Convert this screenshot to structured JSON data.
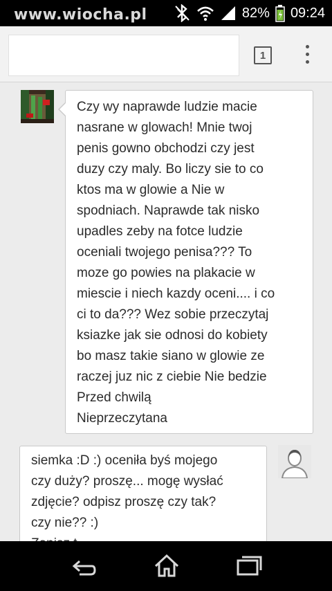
{
  "status_bar": {
    "watermark": "www.wiocha.pl",
    "battery_percent": "82%",
    "time": "09:24"
  },
  "browser": {
    "url_value": "",
    "tab_count": "1"
  },
  "messages": [
    {
      "lines": [
        "Czy wy naprawde ludzie macie",
        "nasrane w glowach! Mnie twoj",
        "penis gowno obchodzi czy jest",
        "duzy czy maly. Bo liczy sie to co",
        "ktos ma w glowie a Nie w",
        "spodniach. Naprawde tak nisko",
        "upadles zeby na fotce ludzie",
        "oceniali twojego penisa??? To",
        "moze go powies na plakacie w",
        "miescie i niech kazdy oceni.... i co",
        "ci to da??? Wez sobie przeczytaj",
        "ksiazke jak sie odnosi do kobiety",
        "bo masz takie siano w glowie ze",
        "raczej juz nic z ciebie Nie bedzie"
      ],
      "time_label": "Przed chwilą",
      "status_label": "Nieprzeczytana"
    },
    {
      "lines": [
        "siemka :D :) oceniła byś mojego",
        "czy duży? proszę... mogę wysłać",
        "zdjęcie? odpisz proszę czy tak?",
        "czy nie?? :)",
        "Zapisz t..."
      ]
    }
  ],
  "icons": {
    "status": [
      "bluetooth-icon",
      "wifi-icon",
      "signal-icon",
      "battery-icon"
    ],
    "nav": [
      "back-icon",
      "home-icon",
      "recent-apps-icon"
    ]
  },
  "colors": {
    "status_bar": "#000000",
    "page_background": "#ececec",
    "bubble_background": "#ffffff",
    "bubble_border": "#c9c9c9",
    "battery_fill": "#7cc23a"
  }
}
